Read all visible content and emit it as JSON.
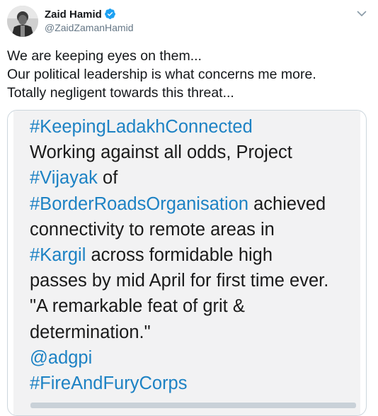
{
  "author": {
    "name": "Zaid Hamid",
    "handle": "@ZaidZamanHamid",
    "verified": true
  },
  "icons": {
    "verified": "verified-badge-icon",
    "menu": "chevron-down-icon"
  },
  "colors": {
    "link": "#1d82c4",
    "verified": "#1da1f2",
    "handle": "#657786",
    "text": "#14171a"
  },
  "tweet": {
    "lines": [
      "We are keeping eyes on them...",
      "Our political leadership is what concerns me more.",
      "Totally negligent towards this threat..."
    ]
  },
  "media": {
    "hashtag_1": "#KeepingLadakhConnected",
    "line_2": "Working against all odds, Project",
    "hashtag_2": "#Vijayak",
    "word_of": "of",
    "hashtag_3": "#BorderRoadsOrganisation",
    "word_achieved": "achieved",
    "line_5": "connectivity to remote areas in",
    "hashtag_4": "#Kargil",
    "line_6_rest": "across formidable high",
    "line_7": "passes by mid April for first time ever.",
    "line_8": "\"A remarkable feat of grit &",
    "line_9": "determination.\"",
    "mention": "@adgpi",
    "hashtag_5": "#FireAndFuryCorps"
  }
}
